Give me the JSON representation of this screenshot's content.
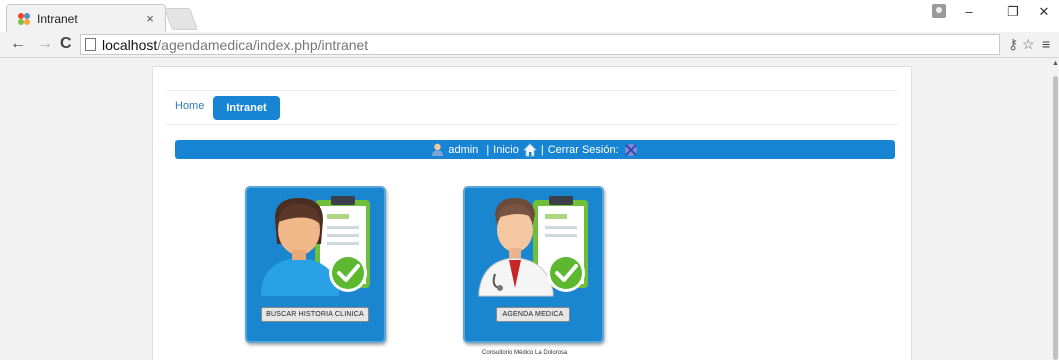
{
  "browser": {
    "tab_title": "Intranet",
    "tab_close": "×",
    "url_host": "localhost",
    "url_path": "/agendamedica/index.php/intranet",
    "window_controls": [
      "–",
      "❐",
      "✕"
    ]
  },
  "nav": {
    "home_label": "Home",
    "intranet_label": "Intranet"
  },
  "userbar": {
    "user": "admin",
    "separator": "|",
    "inicio": "Inicio",
    "cerrar": "Cerrar Sesión:"
  },
  "tiles": [
    {
      "label": "BUSCAR HISTORIA CLINICA",
      "icon": "patient-record-icon"
    },
    {
      "label": "AGENDA MEDICA",
      "icon": "doctor-record-icon"
    }
  ],
  "footer": "Consultorio Médico La Dolorosa",
  "colors": {
    "primary_blue": "#1785d4",
    "check_green": "#5cb82e",
    "card_bg": "#ffffff",
    "page_bg": "#f2f2f2"
  }
}
